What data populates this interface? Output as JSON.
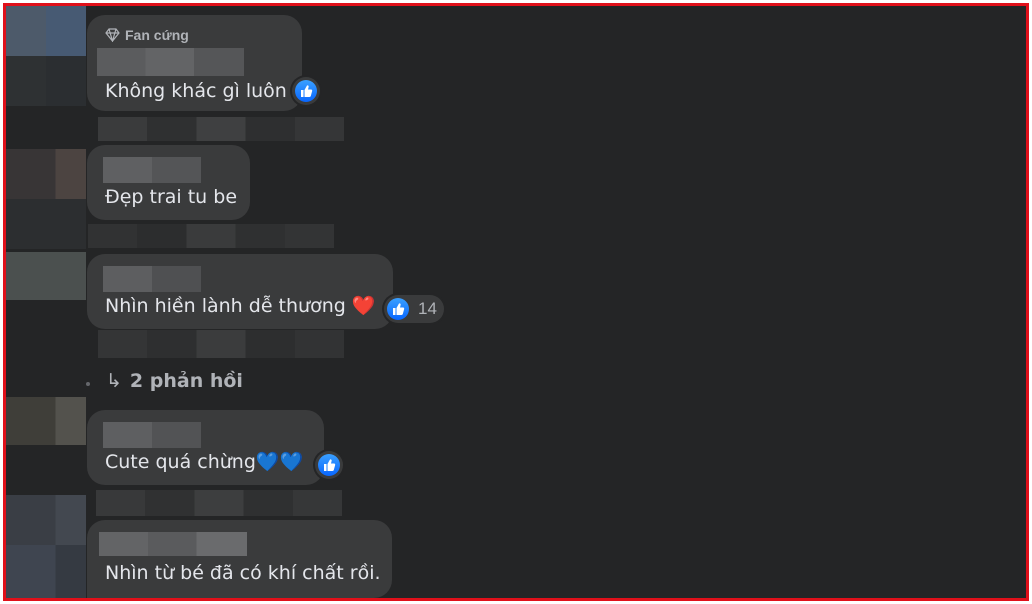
{
  "comments": [
    {
      "badge": "Fan cứng",
      "text": "Không khác gì luôn",
      "reaction": "like"
    },
    {
      "text": "Đẹp trai tu be"
    },
    {
      "text": "Nhìn hiền lành dễ thương ❤️",
      "reaction": "like",
      "reaction_count": "14"
    },
    {
      "text": "Cute quá chừng💙💙",
      "reaction": "like"
    },
    {
      "text": "Nhìn từ bé đã có khí chất rồi."
    }
  ],
  "replies": {
    "arrow": "↳",
    "label": "2 phản hồi"
  },
  "icons": {
    "badge": "diamond-icon",
    "reaction": "thumbs-up-icon",
    "replies": "reply-arrow-icon"
  },
  "colors": {
    "border": "#e0101a",
    "background": "#242526",
    "bubble": "#3a3b3c",
    "text": "#e4e6eb",
    "muted": "#b0b3b8",
    "like": "#0866ff"
  }
}
